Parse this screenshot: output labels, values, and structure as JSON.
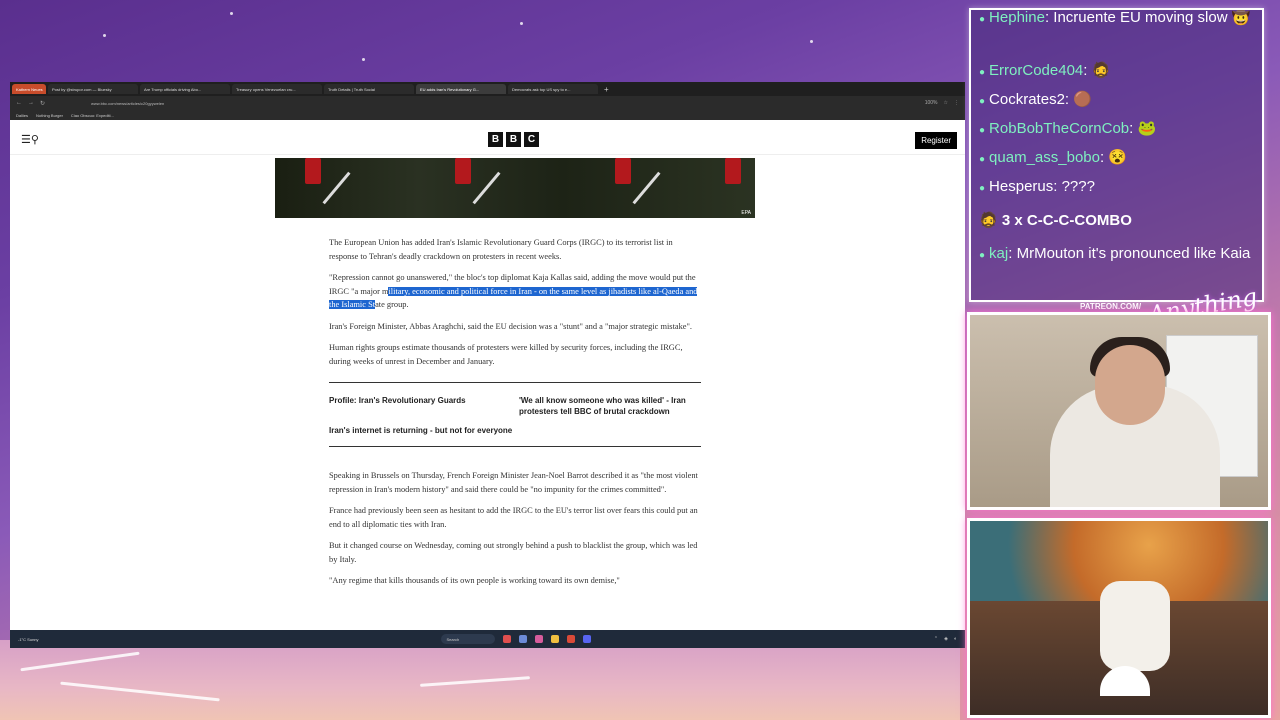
{
  "browser": {
    "tabs": [
      {
        "label": "Kathern Neues"
      },
      {
        "label": "Post by @strupor.com — Bluesky"
      },
      {
        "label": "Are Trump officials driving Abo..."
      },
      {
        "label": "Treasury opens Venezuelan cru..."
      },
      {
        "label": "Truth Details | Truth Social"
      },
      {
        "label": "EU adds Iran's Revolutionary G..."
      },
      {
        "label": "Democrats ask top US spy to e..."
      }
    ],
    "url": "www.bbc.com/news/articles/c20gyywelen",
    "zoom": "100%",
    "bookmarks": [
      "Dallies",
      "Nothing Burger",
      "Ciao Obscuo: Expediti..."
    ]
  },
  "bbc": {
    "register_label": "Register",
    "logo_letters": [
      "B",
      "B",
      "C"
    ],
    "image_credit": "EPA",
    "paragraphs": {
      "p1": "The European Union has added Iran's Islamic Revolutionary Guard Corps (IRGC) to its terrorist list in response to Tehran's deadly crackdown on protesters in recent weeks.",
      "p2_before": "\"Repression cannot go unanswered,\" the bloc's top diplomat Kaja Kallas said, adding the move would put the IRGC \"a major m",
      "p2_highlight": "ilitary, economic and political force in Iran - on the same level as jihadists like al-Qaeda and the Islamic St",
      "p2_after": "ate group.",
      "p3": "Iran's Foreign Minister, Abbas Araghchi, said the EU decision was a \"stunt\" and a \"major strategic mistake\".",
      "p4": "Human rights groups estimate thousands of protesters were killed by security forces, including the IRGC, during weeks of unrest in December and January.",
      "p5": "Speaking in Brussels on Thursday, French Foreign Minister Jean-Noel Barrot described it as \"the most violent repression in Iran's modern history\" and said there could be \"no impunity for the crimes committed\".",
      "p6": "France had previously been seen as hesitant to add the IRGC to the EU's terror list over fears this could put an end to all diplomatic ties with Iran.",
      "p7": "But it changed course on Wednesday, coming out strongly behind a push to blacklist the group, which was led by Italy.",
      "p8": "\"Any regime that kills thousands of its own people is working toward its own demise,\""
    },
    "related": [
      "Profile: Iran's Revolutionary Guards",
      "'We all know someone who was killed' - Iran protesters tell BBC of brutal crackdown",
      "Iran's internet is returning - but not for everyone"
    ]
  },
  "taskbar": {
    "weather_temp": "-1°C",
    "weather_desc": "Sunny",
    "search_label": "Search"
  },
  "chat": {
    "messages": [
      {
        "user": "Hephine",
        "text": "Incruente EU moving slow"
      },
      {
        "user": "ErrorCode404",
        "text": ""
      },
      {
        "user": "Cockrates2",
        "text": ""
      },
      {
        "user": "RobBobTheCornCob",
        "text": ""
      },
      {
        "user": "quam_ass_bobo",
        "text": ""
      },
      {
        "user": "Hesperus",
        "text": "????"
      },
      {
        "user": "kaj",
        "text": "MrMouton it's pronounced like Kaia"
      }
    ],
    "combo": "3 x C-C-C-COMBO"
  },
  "overlay": {
    "patreon": "PATREON.COM/",
    "signature": "Anything Else?"
  },
  "colors": {
    "highlight": "#1e66d0",
    "chat_user": "#7ff0c0",
    "bbc_black": "#111111"
  }
}
